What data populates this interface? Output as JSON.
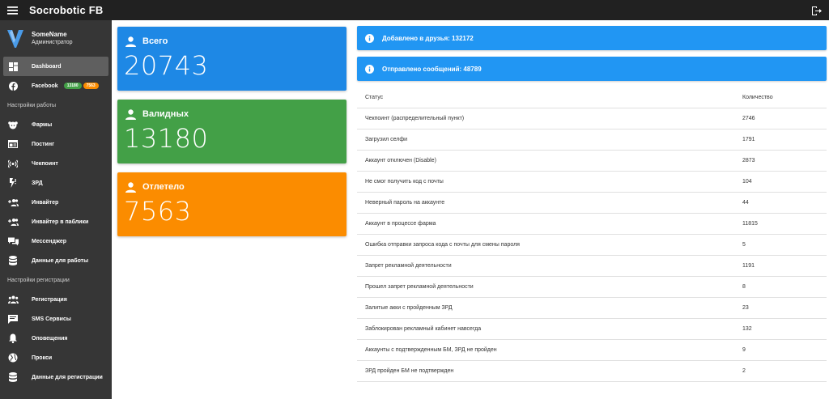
{
  "app": {
    "title": "Socrobotic FB"
  },
  "colors": {
    "topbar": "#212121",
    "sidebar": "#363636",
    "blue": "#1e88e5",
    "green": "#43a047",
    "orange": "#fb8c00",
    "info": "#2196f3"
  },
  "user": {
    "name": "SomeName",
    "role": "Администратор"
  },
  "sidebar": {
    "top_items": [
      {
        "label": "Dashboard",
        "icon": "dashboard-icon",
        "active": true
      },
      {
        "label": "Facebook",
        "icon": "facebook-icon",
        "badge_green": "13180",
        "badge_orange": "7563"
      }
    ],
    "section_work": "Настройки работы",
    "work_items": [
      {
        "label": "Фармы",
        "icon": "farm-icon"
      },
      {
        "label": "Постинг",
        "icon": "posting-icon"
      },
      {
        "label": "Чекпоинт",
        "icon": "checkpoint-icon"
      },
      {
        "label": "ЗРД",
        "icon": "zrd-icon"
      },
      {
        "label": "Инвайтер",
        "icon": "inviter-icon"
      },
      {
        "label": "Инвайтер в паблики",
        "icon": "inviter-public-icon"
      },
      {
        "label": "Мессенджер",
        "icon": "messenger-icon"
      },
      {
        "label": "Данные для работы",
        "icon": "database-icon"
      }
    ],
    "section_reg": "Настройки регистрации",
    "reg_items": [
      {
        "label": "Регистрация",
        "icon": "registration-icon"
      },
      {
        "label": "SMS Сервисы",
        "icon": "sms-icon"
      },
      {
        "label": "Оповещения",
        "icon": "bell-icon"
      },
      {
        "label": "Прокси",
        "icon": "globe-icon"
      },
      {
        "label": "Данные для регистрации",
        "icon": "database-icon"
      }
    ]
  },
  "stats": {
    "total": {
      "title": "Всего",
      "value": "20743"
    },
    "valid": {
      "title": "Валидных",
      "value": "13180"
    },
    "fallen": {
      "title": "Отлетело",
      "value": "7563"
    }
  },
  "info": {
    "friends": "Добавлено в друзья: 132172",
    "messages": "Отправлено сообщений: 48789"
  },
  "table": {
    "col_status": "Статус",
    "col_count": "Количество",
    "rows": [
      {
        "status": "Чекпоинт (распределительный пункт)",
        "count": "2746"
      },
      {
        "status": "Загрузил селфи",
        "count": "1791"
      },
      {
        "status": "Аккаунт отключен (Disable)",
        "count": "2873"
      },
      {
        "status": "Не смог получить код с почты",
        "count": "104"
      },
      {
        "status": "Неверный пароль на аккаунте",
        "count": "44"
      },
      {
        "status": "Аккаунт в процессе фарма",
        "count": "11815"
      },
      {
        "status": "Ошибка отправки запроса кода с почты для смены пароля",
        "count": "5"
      },
      {
        "status": "Запрет рекламной деятельности",
        "count": "1191"
      },
      {
        "status": "Прошел запрет рекламной деятельности",
        "count": "8"
      },
      {
        "status": "Залитые акки с пройденным ЗРД",
        "count": "23"
      },
      {
        "status": "Заблокирован рекламный кабинет навсегда",
        "count": "132"
      },
      {
        "status": "Аккаунты с подтвержденным БМ, ЗРД не пройден",
        "count": "9"
      },
      {
        "status": "ЗРД пройден БМ не подтвержден",
        "count": "2"
      }
    ]
  }
}
